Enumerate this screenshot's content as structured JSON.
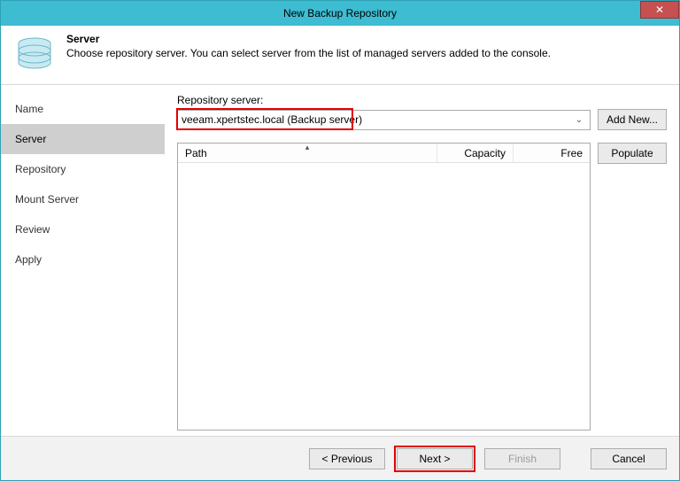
{
  "titlebar": {
    "text": "New Backup Repository"
  },
  "header": {
    "title": "Server",
    "subtitle": "Choose repository server. You can select server from the list of managed servers added to the console."
  },
  "sidebar": {
    "items": [
      {
        "label": "Name"
      },
      {
        "label": "Server"
      },
      {
        "label": "Repository"
      },
      {
        "label": "Mount Server"
      },
      {
        "label": "Review"
      },
      {
        "label": "Apply"
      }
    ],
    "selected_index": 1
  },
  "content": {
    "server_label": "Repository server:",
    "server_value": "veeam.xpertstec.local (Backup server)",
    "add_new_label": "Add New...",
    "populate_label": "Populate",
    "grid": {
      "columns": {
        "path": "Path",
        "capacity": "Capacity",
        "free": "Free"
      },
      "rows": []
    }
  },
  "footer": {
    "previous": "< Previous",
    "next": "Next >",
    "finish": "Finish",
    "cancel": "Cancel"
  }
}
